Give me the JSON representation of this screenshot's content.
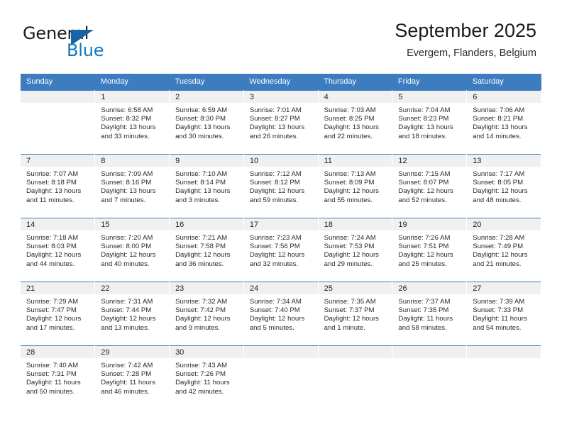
{
  "logo": {
    "word1": "General",
    "word2": "Blue",
    "triangle_color": "#1565a8",
    "blue_color": "#1278be",
    "icon": "triangle-icon"
  },
  "header": {
    "title": "September 2025",
    "subtitle": "Evergem, Flanders, Belgium"
  },
  "colors": {
    "header_blue": "#3c7cbf",
    "band_gray": "#f0f0f0",
    "text": "#2a2a2a"
  },
  "calendar": {
    "weekday_headers": [
      "Sunday",
      "Monday",
      "Tuesday",
      "Wednesday",
      "Thursday",
      "Friday",
      "Saturday"
    ],
    "weeks": [
      [
        {
          "day": ""
        },
        {
          "day": "1",
          "sunrise": "Sunrise: 6:58 AM",
          "sunset": "Sunset: 8:32 PM",
          "daylight1": "Daylight: 13 hours",
          "daylight2": "and 33 minutes."
        },
        {
          "day": "2",
          "sunrise": "Sunrise: 6:59 AM",
          "sunset": "Sunset: 8:30 PM",
          "daylight1": "Daylight: 13 hours",
          "daylight2": "and 30 minutes."
        },
        {
          "day": "3",
          "sunrise": "Sunrise: 7:01 AM",
          "sunset": "Sunset: 8:27 PM",
          "daylight1": "Daylight: 13 hours",
          "daylight2": "and 26 minutes."
        },
        {
          "day": "4",
          "sunrise": "Sunrise: 7:03 AM",
          "sunset": "Sunset: 8:25 PM",
          "daylight1": "Daylight: 13 hours",
          "daylight2": "and 22 minutes."
        },
        {
          "day": "5",
          "sunrise": "Sunrise: 7:04 AM",
          "sunset": "Sunset: 8:23 PM",
          "daylight1": "Daylight: 13 hours",
          "daylight2": "and 18 minutes."
        },
        {
          "day": "6",
          "sunrise": "Sunrise: 7:06 AM",
          "sunset": "Sunset: 8:21 PM",
          "daylight1": "Daylight: 13 hours",
          "daylight2": "and 14 minutes."
        }
      ],
      [
        {
          "day": "7",
          "sunrise": "Sunrise: 7:07 AM",
          "sunset": "Sunset: 8:18 PM",
          "daylight1": "Daylight: 13 hours",
          "daylight2": "and 11 minutes."
        },
        {
          "day": "8",
          "sunrise": "Sunrise: 7:09 AM",
          "sunset": "Sunset: 8:16 PM",
          "daylight1": "Daylight: 13 hours",
          "daylight2": "and 7 minutes."
        },
        {
          "day": "9",
          "sunrise": "Sunrise: 7:10 AM",
          "sunset": "Sunset: 8:14 PM",
          "daylight1": "Daylight: 13 hours",
          "daylight2": "and 3 minutes."
        },
        {
          "day": "10",
          "sunrise": "Sunrise: 7:12 AM",
          "sunset": "Sunset: 8:12 PM",
          "daylight1": "Daylight: 12 hours",
          "daylight2": "and 59 minutes."
        },
        {
          "day": "11",
          "sunrise": "Sunrise: 7:13 AM",
          "sunset": "Sunset: 8:09 PM",
          "daylight1": "Daylight: 12 hours",
          "daylight2": "and 55 minutes."
        },
        {
          "day": "12",
          "sunrise": "Sunrise: 7:15 AM",
          "sunset": "Sunset: 8:07 PM",
          "daylight1": "Daylight: 12 hours",
          "daylight2": "and 52 minutes."
        },
        {
          "day": "13",
          "sunrise": "Sunrise: 7:17 AM",
          "sunset": "Sunset: 8:05 PM",
          "daylight1": "Daylight: 12 hours",
          "daylight2": "and 48 minutes."
        }
      ],
      [
        {
          "day": "14",
          "sunrise": "Sunrise: 7:18 AM",
          "sunset": "Sunset: 8:03 PM",
          "daylight1": "Daylight: 12 hours",
          "daylight2": "and 44 minutes."
        },
        {
          "day": "15",
          "sunrise": "Sunrise: 7:20 AM",
          "sunset": "Sunset: 8:00 PM",
          "daylight1": "Daylight: 12 hours",
          "daylight2": "and 40 minutes."
        },
        {
          "day": "16",
          "sunrise": "Sunrise: 7:21 AM",
          "sunset": "Sunset: 7:58 PM",
          "daylight1": "Daylight: 12 hours",
          "daylight2": "and 36 minutes."
        },
        {
          "day": "17",
          "sunrise": "Sunrise: 7:23 AM",
          "sunset": "Sunset: 7:56 PM",
          "daylight1": "Daylight: 12 hours",
          "daylight2": "and 32 minutes."
        },
        {
          "day": "18",
          "sunrise": "Sunrise: 7:24 AM",
          "sunset": "Sunset: 7:53 PM",
          "daylight1": "Daylight: 12 hours",
          "daylight2": "and 29 minutes."
        },
        {
          "day": "19",
          "sunrise": "Sunrise: 7:26 AM",
          "sunset": "Sunset: 7:51 PM",
          "daylight1": "Daylight: 12 hours",
          "daylight2": "and 25 minutes."
        },
        {
          "day": "20",
          "sunrise": "Sunrise: 7:28 AM",
          "sunset": "Sunset: 7:49 PM",
          "daylight1": "Daylight: 12 hours",
          "daylight2": "and 21 minutes."
        }
      ],
      [
        {
          "day": "21",
          "sunrise": "Sunrise: 7:29 AM",
          "sunset": "Sunset: 7:47 PM",
          "daylight1": "Daylight: 12 hours",
          "daylight2": "and 17 minutes."
        },
        {
          "day": "22",
          "sunrise": "Sunrise: 7:31 AM",
          "sunset": "Sunset: 7:44 PM",
          "daylight1": "Daylight: 12 hours",
          "daylight2": "and 13 minutes."
        },
        {
          "day": "23",
          "sunrise": "Sunrise: 7:32 AM",
          "sunset": "Sunset: 7:42 PM",
          "daylight1": "Daylight: 12 hours",
          "daylight2": "and 9 minutes."
        },
        {
          "day": "24",
          "sunrise": "Sunrise: 7:34 AM",
          "sunset": "Sunset: 7:40 PM",
          "daylight1": "Daylight: 12 hours",
          "daylight2": "and 5 minutes."
        },
        {
          "day": "25",
          "sunrise": "Sunrise: 7:35 AM",
          "sunset": "Sunset: 7:37 PM",
          "daylight1": "Daylight: 12 hours",
          "daylight2": "and 1 minute."
        },
        {
          "day": "26",
          "sunrise": "Sunrise: 7:37 AM",
          "sunset": "Sunset: 7:35 PM",
          "daylight1": "Daylight: 11 hours",
          "daylight2": "and 58 minutes."
        },
        {
          "day": "27",
          "sunrise": "Sunrise: 7:39 AM",
          "sunset": "Sunset: 7:33 PM",
          "daylight1": "Daylight: 11 hours",
          "daylight2": "and 54 minutes."
        }
      ],
      [
        {
          "day": "28",
          "sunrise": "Sunrise: 7:40 AM",
          "sunset": "Sunset: 7:31 PM",
          "daylight1": "Daylight: 11 hours",
          "daylight2": "and 50 minutes."
        },
        {
          "day": "29",
          "sunrise": "Sunrise: 7:42 AM",
          "sunset": "Sunset: 7:28 PM",
          "daylight1": "Daylight: 11 hours",
          "daylight2": "and 46 minutes."
        },
        {
          "day": "30",
          "sunrise": "Sunrise: 7:43 AM",
          "sunset": "Sunset: 7:26 PM",
          "daylight1": "Daylight: 11 hours",
          "daylight2": "and 42 minutes."
        },
        {
          "day": ""
        },
        {
          "day": ""
        },
        {
          "day": ""
        },
        {
          "day": ""
        }
      ]
    ]
  }
}
